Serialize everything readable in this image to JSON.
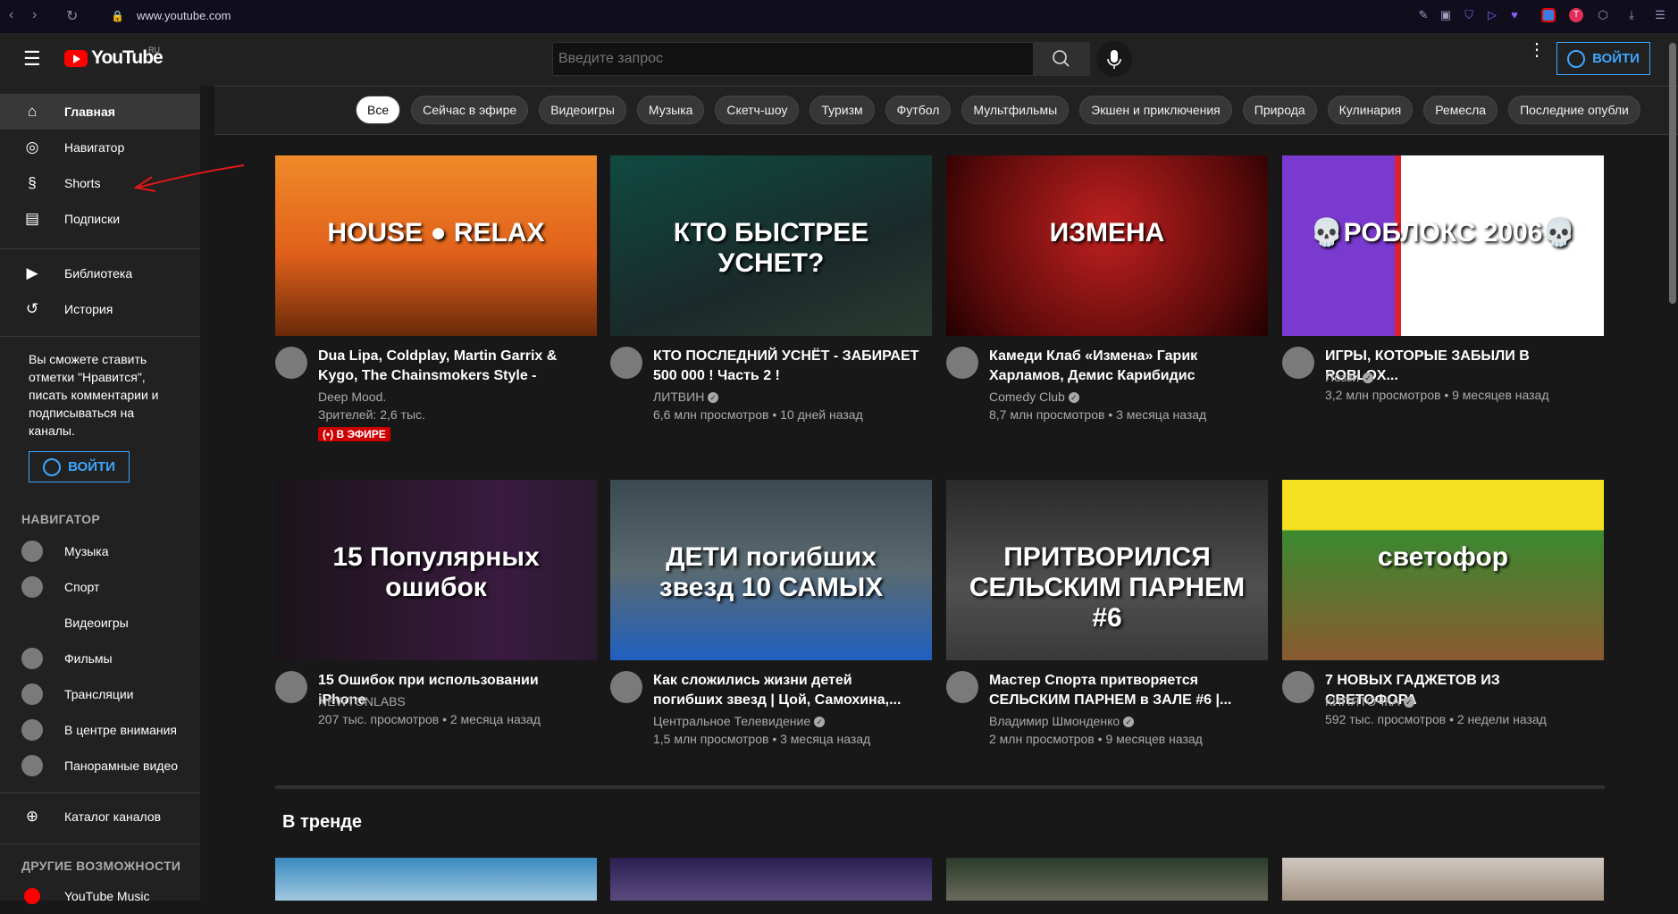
{
  "browser": {
    "url": "www.youtube.com",
    "icons": [
      "back-icon",
      "forward-icon",
      "reload-icon",
      "lock-icon"
    ]
  },
  "header": {
    "logo": "YouTube",
    "region": "RU",
    "search_placeholder": "Введите запрос",
    "signin": "ВОЙТИ"
  },
  "sidebar": {
    "main": [
      {
        "label": "Главная",
        "icon": "home-icon"
      },
      {
        "label": "Навигатор",
        "icon": "compass-icon"
      },
      {
        "label": "Shorts",
        "icon": "shorts-icon"
      },
      {
        "label": "Подписки",
        "icon": "subscriptions-icon"
      }
    ],
    "library": [
      {
        "label": "Библиотека",
        "icon": "library-icon"
      },
      {
        "label": "История",
        "icon": "history-icon"
      }
    ],
    "promo": "Вы сможете ставить отметки \"Нравится\", писать комментарии и подписываться на каналы.",
    "promo_button": "ВОЙТИ",
    "nav_heading": "НАВИГАТОР",
    "nav": [
      {
        "label": "Музыка",
        "dot": true
      },
      {
        "label": "Спорт",
        "dot": true
      },
      {
        "label": "Видеоигры",
        "dot": false
      },
      {
        "label": "Фильмы",
        "dot": true
      },
      {
        "label": "Трансляции",
        "dot": true
      },
      {
        "label": "В центре внимания",
        "dot": true
      },
      {
        "label": "Панорамные видео",
        "dot": true
      }
    ],
    "catalog": "Каталог каналов",
    "other_heading": "ДРУГИЕ ВОЗМОЖНОСТИ",
    "other": [
      {
        "label": "YouTube Music"
      }
    ]
  },
  "chips": [
    "Все",
    "Сейчас в эфире",
    "Видеоигры",
    "Музыка",
    "Скетч-шоу",
    "Туризм",
    "Футбол",
    "Мультфильмы",
    "Экшен и приключения",
    "Природа",
    "Кулинария",
    "Ремесла",
    "Последние опубли"
  ],
  "videos": [
    {
      "title": "Dua Lipa, Coldplay, Martin Garrix & Kygo, The Chainsmokers Style - Feelin...",
      "channel": "Deep Mood.",
      "verified": false,
      "info": "Зрителей: 2,6 тыс.",
      "live": "(•) В ЭФИРЕ",
      "thumb_text": "HOUSE ● RELAX",
      "bg": "linear-gradient(180deg,#f08a2a,#e0601a 55%,#6a2a0a)"
    },
    {
      "title": "КТО ПОСЛЕДНИЙ УСНЁТ - ЗАБИРАЕТ 500 000 ! Часть 2 !",
      "channel": "ЛИТВИН",
      "verified": true,
      "info": "6,6 млн просмотров • 10 дней назад",
      "thumb_text": "КТО БЫСТРЕЕ УСНЕТ?",
      "bg": "linear-gradient(160deg,#0f4a40,#1a2a2a 60%,#2a3a30)"
    },
    {
      "title": "Камеди Клаб «Измена» Гарик Харламов, Демис Карибидис",
      "channel": "Comedy Club",
      "verified": true,
      "info": "8,7 млн просмотров • 3 месяца назад",
      "thumb_text": "ИЗМЕНА",
      "bg": "radial-gradient(circle at 50% 40%,#c02020,#5a0a0a 70%,#200)"
    },
    {
      "title": "ИГРЫ, КОТОРЫЕ ЗАБЫЛИ В ROBLOX...",
      "channel": "Поззи",
      "verified": true,
      "info": "3,2 млн просмотров • 9 месяцев назад",
      "thumb_text": "💀РОБЛОКС 2006💀",
      "bg": "linear-gradient(90deg,#7a3ad0 0 35%,#e02030 35% 37%,#ffffff 37%)"
    },
    {
      "title": "15 Ошибок при использовании iPhone",
      "channel": "NEWTONLABS",
      "verified": false,
      "info": "207 тыс. просмотров • 2 месяца назад",
      "thumb_text": "15 Популярных ошибок",
      "bg": "linear-gradient(90deg,#1a1418,#3a1a40 70%,#2a1a30)"
    },
    {
      "title": "Как сложились жизни детей погибших звезд | Цой, Самохина,...",
      "channel": "Центральное Телевидение",
      "verified": true,
      "info": "1,5 млн просмотров • 3 месяца назад",
      "thumb_text": "ДЕТИ погибших звезд 10 САМЫХ",
      "bg": "linear-gradient(180deg,#3a4a50,#5a6a70 50%,#2060c0)"
    },
    {
      "title": "Мастер Спорта притворяется СЕЛЬСКИМ ПАРНЕМ в ЗАЛЕ #6 |...",
      "channel": "Владимир Шмонденко",
      "verified": true,
      "info": "2 млн просмотров • 9 месяцев назад",
      "thumb_text": "ПРИТВОРИЛСЯ СЕЛЬСКИМ ПАРНЕМ #6",
      "bg": "linear-gradient(180deg,#2a2a2a,#505050 60%,#3a3a3a)"
    },
    {
      "title": "7 НОВЫХ ГАДЖЕТОВ ИЗ СВЕТОФОРА",
      "channel": "КИПЯТОЧКА",
      "verified": true,
      "info": "592 тыс. просмотров • 2 недели назад",
      "thumb_text": "светофор",
      "bg": "linear-gradient(180deg,#f5e020 0 28%,#3a8a30 28%,#8a5a30)"
    }
  ],
  "trending": {
    "title": "В тренде"
  }
}
